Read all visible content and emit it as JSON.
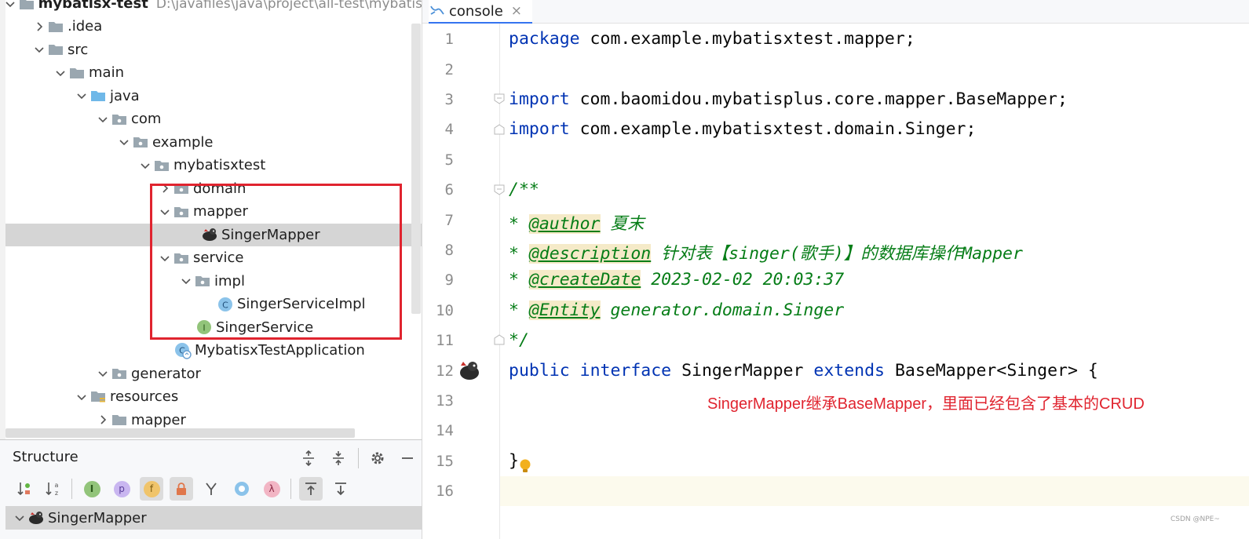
{
  "project_tree": {
    "items": [
      {
        "label": "mybatisx-test",
        "extra": "D:\\javafiles\\java\\project\\all-test\\mybatis"
      },
      {
        "label": ".idea"
      },
      {
        "label": "src"
      },
      {
        "label": "main"
      },
      {
        "label": "java"
      },
      {
        "label": "com"
      },
      {
        "label": "example"
      },
      {
        "label": "mybatisxtest"
      },
      {
        "label": "domain"
      },
      {
        "label": "mapper"
      },
      {
        "label": "SingerMapper"
      },
      {
        "label": "service"
      },
      {
        "label": "impl"
      },
      {
        "label": "SingerServiceImpl"
      },
      {
        "label": "SingerService"
      },
      {
        "label": "MybatisxTestApplication"
      },
      {
        "label": "generator"
      },
      {
        "label": "resources"
      },
      {
        "label": "mapper"
      }
    ]
  },
  "structure": {
    "title": "Structure",
    "root": "SingerMapper",
    "filter_letters": {
      "interface": "I",
      "property": "p",
      "field": "f",
      "lambda": "λ"
    }
  },
  "editor": {
    "tab": "console",
    "tab_close": "×",
    "line_numbers": [
      "1",
      "2",
      "3",
      "4",
      "5",
      "6",
      "7",
      "8",
      "9",
      "10",
      "11",
      "12",
      "13",
      "14",
      "15",
      "16"
    ],
    "code": {
      "l1_kw": "package",
      "l1_rest": " com.example.mybatisxtest.mapper;",
      "l3_kw": "import",
      "l3_rest": " com.baomidou.mybatisplus.core.mapper.BaseMapper;",
      "l4_kw": "import",
      "l4_rest": " com.example.mybatisxtest.domain.Singer;",
      "l6": "/**",
      "l7_star": "* ",
      "l7_tag": "@author",
      "l7_text": " 夏末",
      "l8_star": "* ",
      "l8_tag": "@description",
      "l8_text": " 针对表【singer(歌手)】的数据库操作Mapper",
      "l9_star": "* ",
      "l9_tag": "@createDate",
      "l9_text": " 2023-02-02 20:03:37",
      "l10_star": "* ",
      "l10_tag": "@Entity",
      "l10_text": " generator.domain.Singer",
      "l11": "*/",
      "l12_kw1": "public",
      "l12_kw2": "interface",
      "l12_name": "SingerMapper",
      "l12_kw3": "extends",
      "l12_rest": "BaseMapper<Singer> {",
      "l15": "}"
    },
    "annotation": "SingerMapper继承BaseMapper，里面已经包含了基本的CRUD"
  },
  "watermark": "CSDN @NPE~"
}
